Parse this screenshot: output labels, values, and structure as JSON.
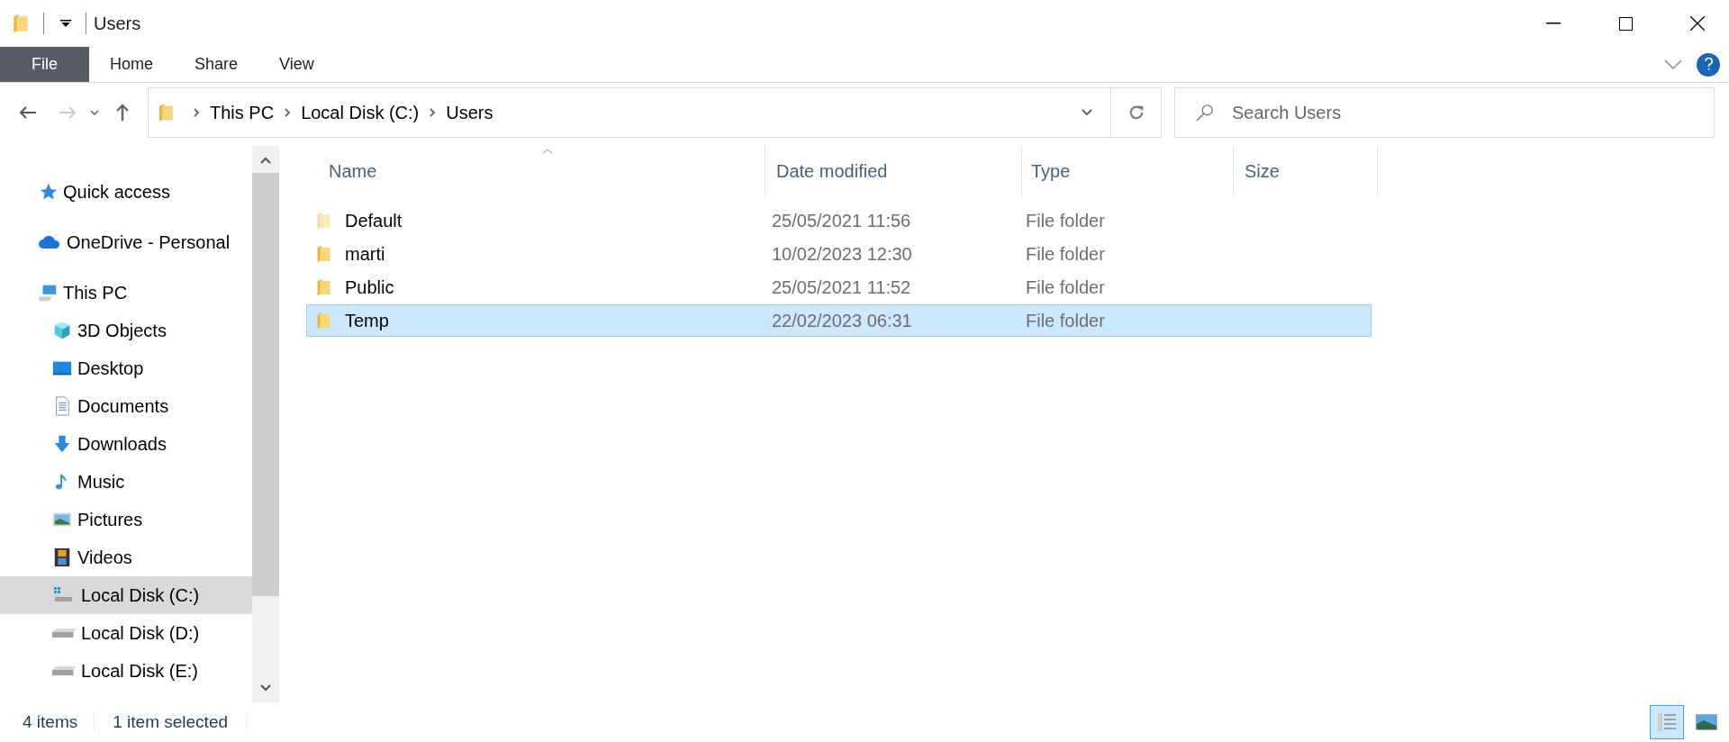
{
  "window": {
    "title": "Users"
  },
  "ribbon": {
    "tabs": [
      {
        "label": "File",
        "kind": "file"
      },
      {
        "label": "Home",
        "kind": "tab"
      },
      {
        "label": "Share",
        "kind": "tab"
      },
      {
        "label": "View",
        "kind": "tab"
      }
    ]
  },
  "address_bar": {
    "path": [
      "This PC",
      "Local Disk (C:)",
      "Users"
    ]
  },
  "search": {
    "placeholder": "Search Users"
  },
  "navigation": {
    "items": [
      {
        "label": "Quick access",
        "kind": "star",
        "selected": false
      },
      {
        "label": "OneDrive - Personal",
        "kind": "cloud",
        "selected": false
      },
      {
        "label": "This PC",
        "kind": "computer",
        "selected": false,
        "children": [
          {
            "label": "3D Objects",
            "kind": "cube",
            "selected": false
          },
          {
            "label": "Desktop",
            "kind": "monitor",
            "selected": false
          },
          {
            "label": "Documents",
            "kind": "document",
            "selected": false
          },
          {
            "label": "Downloads",
            "kind": "download",
            "selected": false
          },
          {
            "label": "Music",
            "kind": "music",
            "selected": false
          },
          {
            "label": "Pictures",
            "kind": "pictures",
            "selected": false
          },
          {
            "label": "Videos",
            "kind": "videos",
            "selected": false
          },
          {
            "label": "Local Disk (C:)",
            "kind": "system-drive",
            "selected": true
          },
          {
            "label": "Local Disk (D:)",
            "kind": "drive",
            "selected": false
          },
          {
            "label": "Local Disk (E:)",
            "kind": "drive",
            "selected": false
          }
        ]
      }
    ]
  },
  "table": {
    "columns": [
      "Name",
      "Date modified",
      "Type",
      "Size"
    ],
    "rows": [
      {
        "name": "Default",
        "date": "25/05/2021 11:56",
        "type": "File folder",
        "hidden": true,
        "selected": false
      },
      {
        "name": "marti",
        "date": "10/02/2023 12:30",
        "type": "File folder",
        "hidden": false,
        "selected": false
      },
      {
        "name": "Public",
        "date": "25/05/2021 11:52",
        "type": "File folder",
        "hidden": false,
        "selected": false
      },
      {
        "name": "Temp",
        "date": "22/02/2023 06:31",
        "type": "File folder",
        "hidden": false,
        "selected": true
      }
    ]
  },
  "status_bar": {
    "items": [
      "4 items",
      "1 item selected"
    ]
  },
  "view_buttons": [
    {
      "kind": "details",
      "selected": true
    },
    {
      "kind": "thumbnails",
      "selected": false
    }
  ]
}
